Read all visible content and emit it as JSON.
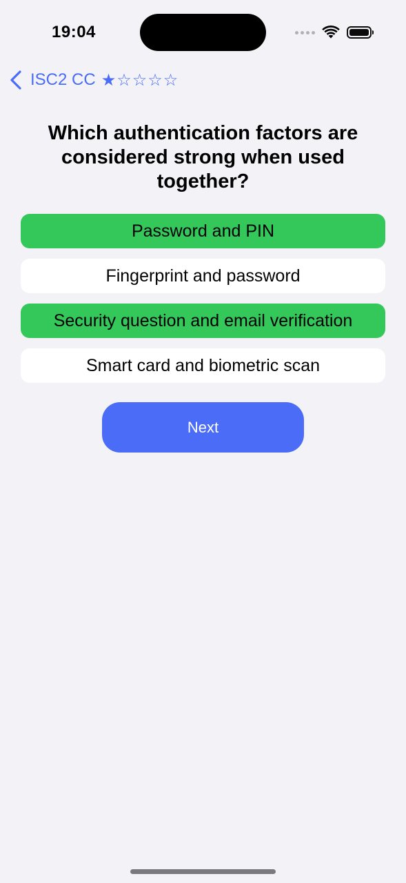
{
  "status_bar": {
    "time": "19:04"
  },
  "nav": {
    "back_title": "ISC2 CC",
    "rating": "★☆☆☆☆",
    "accent_color": "#4a6cf7"
  },
  "question": {
    "text": "Which authentication factors are considered strong when used together?"
  },
  "answers": [
    {
      "label": "Password and PIN",
      "selected": true
    },
    {
      "label": "Fingerprint and password",
      "selected": false
    },
    {
      "label": "Security question and email verification",
      "selected": true
    },
    {
      "label": "Smart card and biometric scan",
      "selected": false
    }
  ],
  "colors": {
    "selected": "#34c759",
    "unselected": "#ffffff",
    "background": "#f2f2f7",
    "button": "#4a6cf7"
  },
  "actions": {
    "next_label": "Next"
  }
}
